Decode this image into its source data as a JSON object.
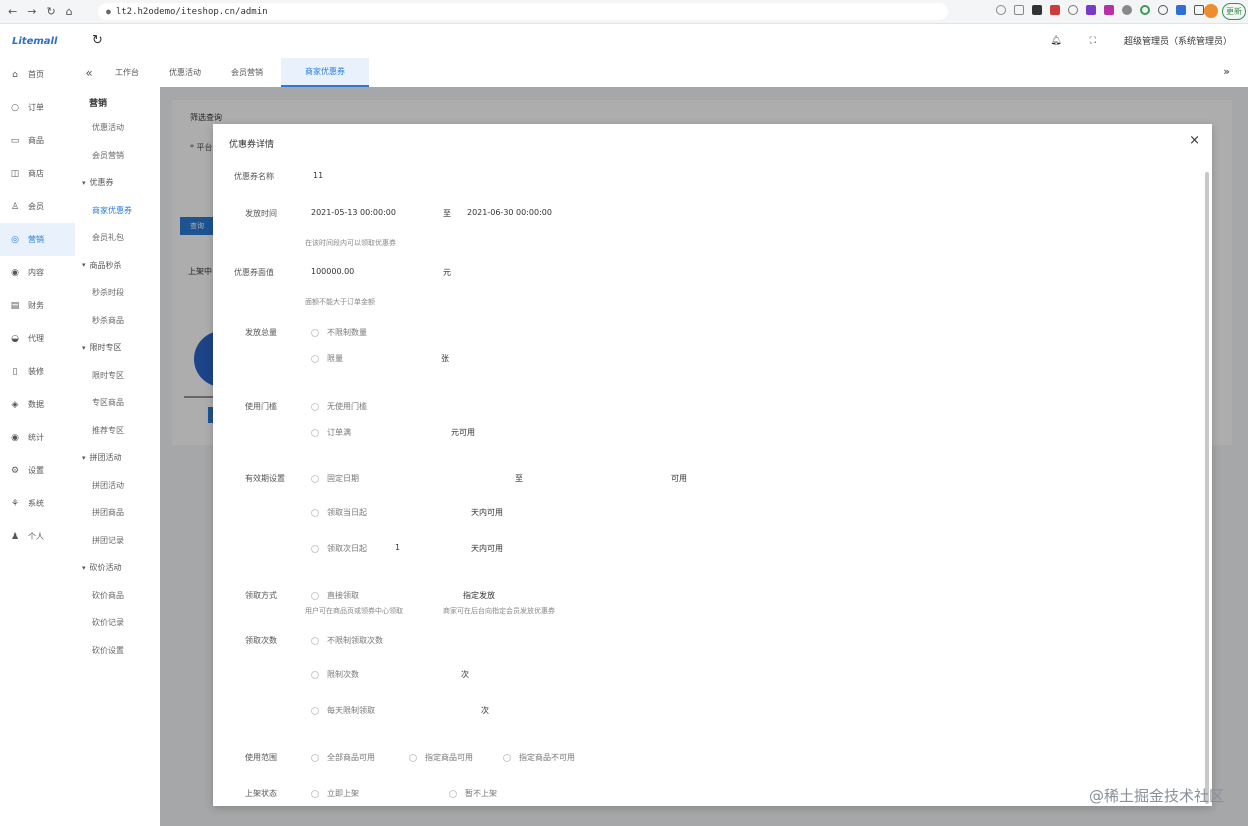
{
  "browser": {
    "url": "lt2.h2odemo/iteshop.cn/admin",
    "update_label": "更新"
  },
  "app": {
    "logo": "Litemall",
    "user_label": "超级管理员（系统管理员）"
  },
  "sidenav": {
    "items": [
      {
        "icon": "home-icon",
        "glyph": "⌂",
        "label": "首页"
      },
      {
        "icon": "order-icon",
        "glyph": "○",
        "label": "订单"
      },
      {
        "icon": "goods-icon",
        "glyph": "▭",
        "label": "商品"
      },
      {
        "icon": "store-icon",
        "glyph": "◫",
        "label": "商店"
      },
      {
        "icon": "user-icon",
        "glyph": "♙",
        "label": "会员"
      },
      {
        "icon": "marketing-icon",
        "glyph": "◎",
        "label": "营销"
      },
      {
        "icon": "content-icon",
        "glyph": "◉",
        "label": "内容"
      },
      {
        "icon": "finance-icon",
        "glyph": "▤",
        "label": "财务"
      },
      {
        "icon": "agent-icon",
        "glyph": "◒",
        "label": "代理"
      },
      {
        "icon": "decor-icon",
        "glyph": "▯",
        "label": "装修"
      },
      {
        "icon": "data-icon",
        "glyph": "◈",
        "label": "数据"
      },
      {
        "icon": "stats-icon",
        "glyph": "◉",
        "label": "统计"
      },
      {
        "icon": "settings-icon",
        "glyph": "⚙",
        "label": "设置"
      },
      {
        "icon": "system-icon",
        "glyph": "⚘",
        "label": "系统"
      },
      {
        "icon": "person-icon",
        "glyph": "♟",
        "label": "个人"
      }
    ],
    "active_index": 5
  },
  "subnav": {
    "title": "营销",
    "rows": [
      {
        "label": "优惠活动",
        "type": "item"
      },
      {
        "label": "会员营销",
        "type": "item"
      },
      {
        "label": "优惠券",
        "type": "group"
      },
      {
        "label": "商家优惠券",
        "type": "item",
        "active": true
      },
      {
        "label": "会员礼包",
        "type": "item"
      },
      {
        "label": "商品秒杀",
        "type": "group"
      },
      {
        "label": "秒杀时段",
        "type": "item"
      },
      {
        "label": "秒杀商品",
        "type": "item"
      },
      {
        "label": "限时专区",
        "type": "group"
      },
      {
        "label": "限时专区",
        "type": "item"
      },
      {
        "label": "专区商品",
        "type": "item"
      },
      {
        "label": "推荐专区",
        "type": "item"
      },
      {
        "label": "拼团活动",
        "type": "group"
      },
      {
        "label": "拼团活动",
        "type": "item"
      },
      {
        "label": "拼团商品",
        "type": "item"
      },
      {
        "label": "拼团记录",
        "type": "item"
      },
      {
        "label": "砍价活动",
        "type": "group"
      },
      {
        "label": "砍价商品",
        "type": "item"
      },
      {
        "label": "砍价记录",
        "type": "item"
      },
      {
        "label": "砍价设置",
        "type": "item"
      }
    ]
  },
  "tabs": [
    {
      "label": "工作台",
      "active": false
    },
    {
      "label": "优惠活动",
      "active": false
    },
    {
      "label": "会员营销",
      "active": false
    },
    {
      "label": "商家优惠券",
      "active": true
    }
  ],
  "background": {
    "section_title": "筛选查询",
    "hint": "* 平台",
    "query_button": "查询",
    "list_label": "上架中"
  },
  "modal": {
    "title": "优惠券详情",
    "fields": {
      "name_label": "优惠券名称",
      "name_value": "11",
      "time_label": "发放时间",
      "time_start": "2021-05-13 00:00:00",
      "time_sep": "至",
      "time_end": "2021-06-30 00:00:00",
      "time_hint": "在该时间段内可以领取优惠券",
      "amount_label": "优惠券面值",
      "amount_value": "100000.00",
      "amount_unit": "元",
      "amount_hint": "面额不能大于订单金额",
      "quota_label": "发放总量",
      "quota_opt1": "不限制数量",
      "quota_opt2": "限量",
      "quota_unit": "张",
      "threshold_label": "使用门槛",
      "threshold_opt1": "无使用门槛",
      "threshold_opt2": "订单满",
      "threshold_unit": "元可用",
      "validity_label": "有效期设置",
      "validity_opt1": "固定日期",
      "validity_sep": "至",
      "validity_end_label": "可用",
      "validity_opt2": "领取当日起",
      "validity_unit2": "天内可用",
      "validity_opt3": "领取次日起",
      "validity_value3": "1",
      "validity_unit3": "天内可用",
      "method_label": "领取方式",
      "method_opt1": "直接领取",
      "method_opt2": "指定发放",
      "method_hint1": "用户可在商品页或领券中心领取",
      "method_hint2": "商家可在后台向指定会员发放优惠券",
      "times_label": "领取次数",
      "times_opt1": "不限制领取次数",
      "times_opt2": "限制次数",
      "times_unit2": "次",
      "times_opt3": "每天限制领取",
      "times_unit3": "次",
      "scope_label": "使用范围",
      "scope_opt1": "全部商品可用",
      "scope_opt2": "指定商品可用",
      "scope_opt3": "指定商品不可用",
      "status_label": "上架状态",
      "status_opt1": "立即上架",
      "status_opt2": "暂不上架"
    }
  },
  "watermark": "@稀土掘金技术社区"
}
